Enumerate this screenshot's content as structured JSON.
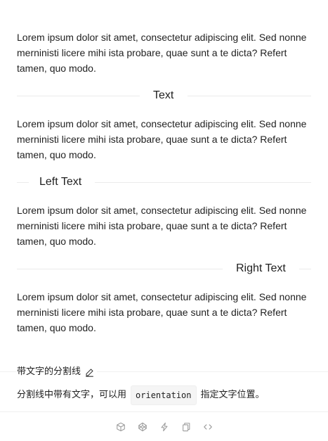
{
  "demo": {
    "paragraph": "Lorem ipsum dolor sit amet, consectetur adipiscing elit. Sed nonne merninisti licere mihi ista probare, quae sunt a te dicta? Refert tamen, quo modo.",
    "dividers": {
      "center": "Text",
      "left": "Left Text",
      "right": "Right Text"
    }
  },
  "meta": {
    "title": "带文字的分割线",
    "desc_before": "分割线中带有文字，可以用",
    "desc_code": "orientation",
    "desc_after": "指定文字位置。"
  },
  "actions": [
    {
      "icon": "codesandbox-icon"
    },
    {
      "icon": "codepen-icon"
    },
    {
      "icon": "thunderbolt-icon"
    },
    {
      "icon": "copy-icon"
    },
    {
      "icon": "code-expand-icon"
    }
  ],
  "colors": {
    "text": "#1f1f1f",
    "divider": "#ebebeb",
    "icon": "#9a9a9a",
    "code_bg": "#f5f5f5"
  }
}
